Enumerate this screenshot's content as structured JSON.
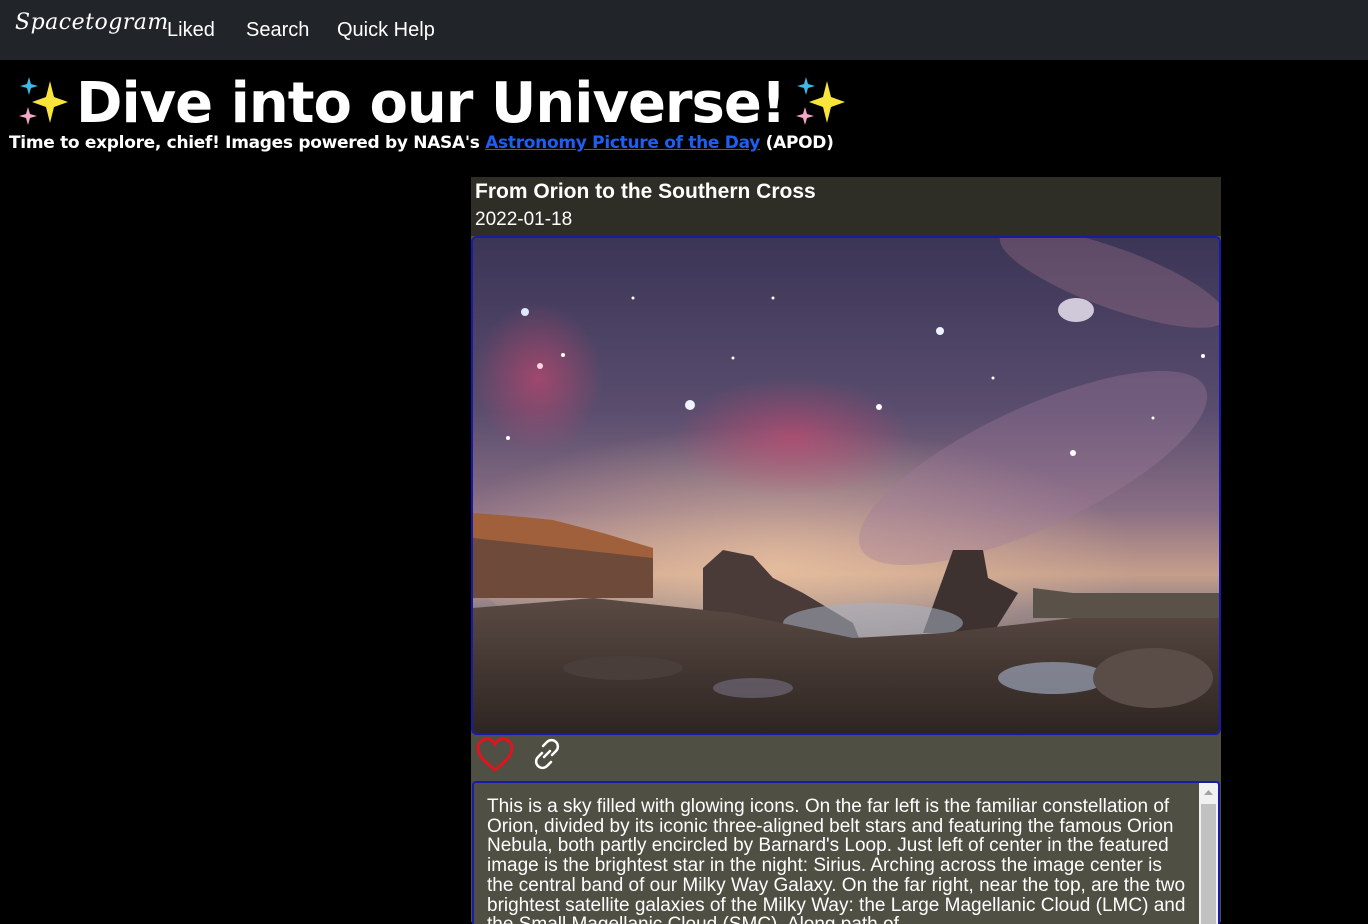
{
  "nav": {
    "brand": "Spacetogram",
    "links": [
      "Liked",
      "Search",
      "Quick Help"
    ]
  },
  "hero": {
    "title": "Dive into our Universe!",
    "subtitle_prefix": "Time to explore, chief! Images powered by NASA's ",
    "subtitle_link": "Astronomy Picture of the Day",
    "subtitle_suffix": " (APOD)",
    "sparkle_icon": "sparkles-icon"
  },
  "post": {
    "title": "From Orion to the Southern Cross",
    "date": "2022-01-18",
    "image_alt": "From Orion to the Southern Cross",
    "liked": false,
    "description": "This is a sky filled with glowing icons. On the far left is the familiar constellation of Orion, divided by its iconic three-aligned belt stars and featuring the famous Orion Nebula, both partly encircled by Barnard's Loop. Just left of center in the featured image is the brightest star in the night: Sirius. Arching across the image center is the central band of our Milky Way Galaxy. On the far right, near the top, are the two brightest satellite galaxies of the Milky Way: the Large Magellanic Cloud (LMC) and the Small Magellanic Cloud (SMC). Along path of"
  },
  "icons": {
    "like": "heart-icon",
    "share": "link-icon"
  },
  "colors": {
    "navbar_bg": "#212529",
    "page_bg": "#000000",
    "card_header_bg": "#2e2e27",
    "card_bg": "#4f4f44",
    "accent_border": "#1a1aa8",
    "link": "#1e5ff0",
    "heart": "#e0141e"
  }
}
